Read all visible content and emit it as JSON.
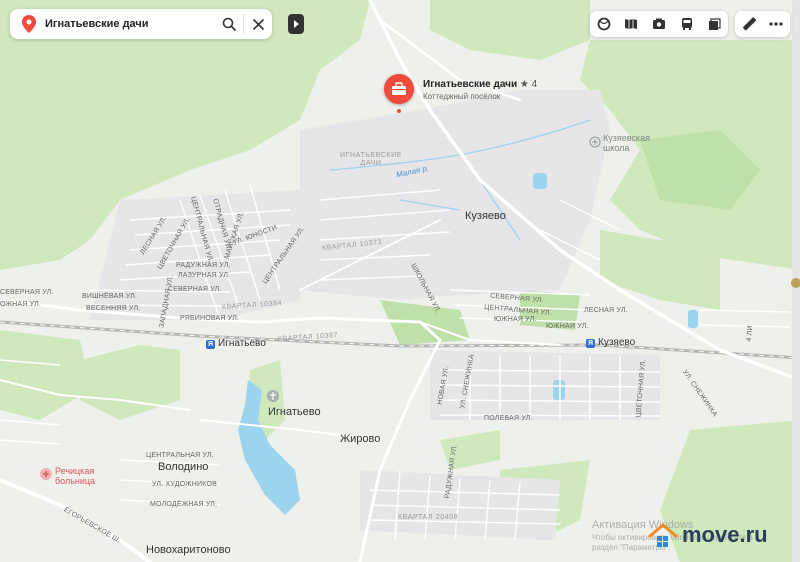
{
  "search": {
    "query": "Игнатьевские дачи",
    "icons": [
      "location-pin-icon",
      "search-icon",
      "close-icon"
    ]
  },
  "toolbar": {
    "icons": [
      "layers-icon",
      "map-book-icon",
      "photo-icon",
      "bus-icon",
      "stack-icon",
      "ruler-icon",
      "more-icon"
    ]
  },
  "marker": {
    "title": "Игнатьевские дачи",
    "rating": "★ 4",
    "subtitle": "Коттеджный посёлок",
    "color": "#ef4a3b"
  },
  "places": {
    "kuzyaevo": "Кузяево",
    "ignatyevo": "Игнатьево",
    "zhirovo": "Жирово",
    "volodino": "Володино",
    "novokharitonovo": "Новохаритоново",
    "dachi_area": "ИГНАТЬЕВСКИЕ\nДАЧИ"
  },
  "stations": {
    "ignatyevo": "Игнатьево",
    "kuzyaevo": "Кузяево"
  },
  "pois": {
    "school": "Кузяевская\nшкола",
    "hospital": "Речицкая\nбольница"
  },
  "river": "Малая р.",
  "districts": {
    "q10373": "КВАРТАЛ 10373",
    "q10384": "КВАРТАЛ 10384",
    "q10387": "КВАРТАЛ 10387",
    "q20408": "КВАРТАЛ 20408"
  },
  "streets": {
    "lesnaya1": "ЛЕСНАЯ УЛ.",
    "tsvetochnaya1": "ЦВЕТОЧНАЯ УЛ.",
    "tsentralnaya1": "ЦЕНТРАЛЬНАЯ УЛ.",
    "otradnaya": "ОТРАДНАЯ УЛ.",
    "mayskaya": "МАЙСКАЯ УЛ.",
    "yunosti": "УЛ. ЮНОСТИ",
    "raduzhnaya1": "РАДУЖНАЯ УЛ.",
    "lazurnaya": "ЛАЗУРНАЯ УЛ.",
    "tsentralnaya2": "ЦЕНТРАЛЬНАЯ УЛ.",
    "vishnevaya": "ВИШНЁВАЯ УЛ.",
    "vesennyaya": "ВЕСЕННЯЯ УЛ.",
    "severnaya1": "СЕВЕРНАЯ УЛ.",
    "zapadnaya": "ЗАПАДНАЯ УЛ.",
    "ryabinovaya": "РЯБИНОВАЯ УЛ.",
    "shkolnaya": "ШКОЛЬНАЯ УЛ.",
    "severnaya2": "СЕВЕРНАЯ УЛ.",
    "tsentralnaya3": "ЦЕНТРАЛЬНАЯ УЛ.",
    "yuzhnaya1": "ЮЖНАЯ УЛ.",
    "yuzhnaya2": "ЮЖНАЯ УЛ.",
    "lesnaya2": "ЛЕСНАЯ УЛ.",
    "novaya": "НОВАЯ УЛ.",
    "snezhinka1": "УЛ. СНЕЖИНКА",
    "polevaya": "ПОЛЕВАЯ УЛ.",
    "tsvetochnaya2": "ЦВЕТОЧНАЯ УЛ.",
    "snezhinka2": "УЛ. СНЕЖИНКА",
    "raduzhnaya2": "РАДУЖНАЯ УЛ.",
    "tsentralnaya4": "ЦЕНТРАЛЬНАЯ УЛ.",
    "khudozhnikov": "УЛ. ХУДОЖНИКОВ",
    "molodezhnaya": "МОЛОДЁЖНАЯ УЛ.",
    "egorevskoe": "ЕГОРЬЕВСКОЕ Ш.",
    "v4": "4 ЛИ",
    "severnaya3": "СЕВЕРНАЯ УЛ.",
    "ozhnaya": "ОЖНАЯ УЛ."
  },
  "watermark": {
    "line1": "Активация Windows",
    "line2": "Чтобы активировать Windows, перейдите в",
    "line3": "раздел \"Параметры\"."
  },
  "brand": {
    "name": "move.ru",
    "color": "#2a3f5a"
  },
  "colors": {
    "forest": "#cfe9bd",
    "forest_dark": "#bfe0a8",
    "water": "#9cd3ee",
    "road": "#ffffff",
    "land": "#eef0ec"
  }
}
